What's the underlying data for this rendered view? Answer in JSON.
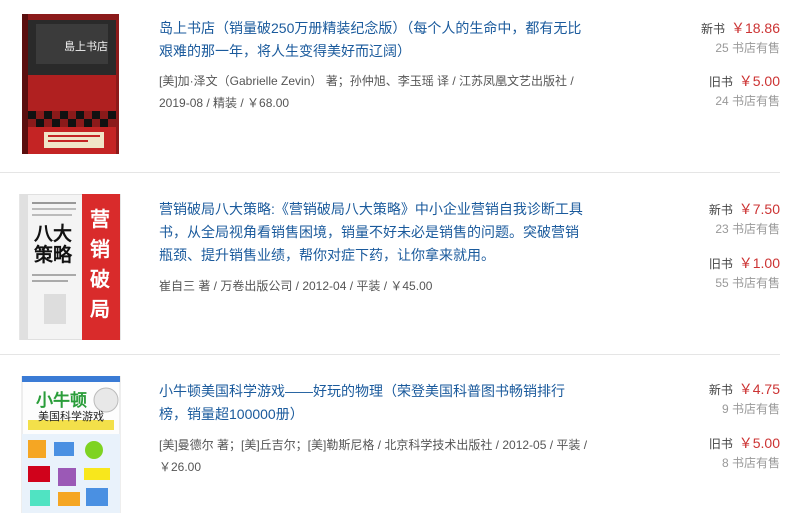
{
  "books": [
    {
      "title": "岛上书店（销量破250万册精装纪念版）（每个人的生命中，都有无比艰难的那一年，将人生变得美好而辽阔）",
      "meta": "[美]加·泽文（Gabrielle Zevin） 著；孙仲旭、李玉瑶 译 / 江苏凤凰文艺出版社 / 2019-08 / 精装 / ￥68.00",
      "cover_text": "島上书店",
      "new": {
        "label": "新书",
        "price": "￥18.86",
        "stores": "25 书店有售"
      },
      "used": {
        "label": "旧书",
        "price": "￥5.00",
        "stores": "24 书店有售"
      }
    },
    {
      "title": "营销破局八大策略:《营销破局八大策略》中小企业营销自我诊断工具书，从全局视角看销售困境，销量不好未必是销售的问题。突破营销瓶颈、提升销售业绩，帮你对症下药，让你拿来就用。",
      "meta": "崔自三 著 / 万卷出版公司 / 2012-04 / 平装 / ￥45.00",
      "cover_text": "八大策略",
      "cover_text2": "营销破局",
      "new": {
        "label": "新书",
        "price": "￥7.50",
        "stores": "23 书店有售"
      },
      "used": {
        "label": "旧书",
        "price": "￥1.00",
        "stores": "55 书店有售"
      }
    },
    {
      "title": "小牛顿美国科学游戏——好玩的物理（荣登美国科普图书畅销排行榜，销量超100000册）",
      "meta": "[美]曼德尔 著；[美]丘吉尔；[美]勒斯尼格 / 北京科学技术出版社 / 2012-05 / 平装 / ￥26.00",
      "cover_text": "小牛顿",
      "cover_text2": "美国科学游戏",
      "new": {
        "label": "新书",
        "price": "￥4.75",
        "stores": "9 书店有售"
      },
      "used": {
        "label": "旧书",
        "price": "￥5.00",
        "stores": "8 书店有售"
      }
    }
  ]
}
